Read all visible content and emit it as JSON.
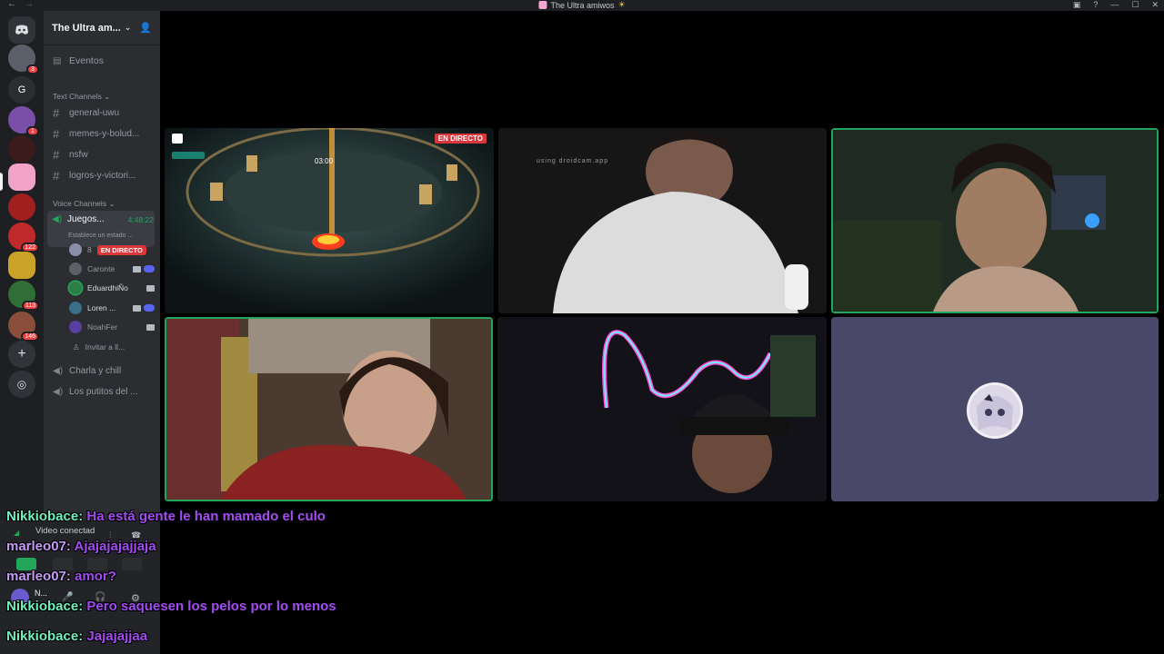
{
  "window": {
    "title": "The Ultra amiwos",
    "title_emoji": "☀"
  },
  "server": {
    "name": "The Ultra am...",
    "rail_badges": [
      "3",
      "1",
      "122",
      "113",
      "146"
    ],
    "rail_letter": "G"
  },
  "sidebar": {
    "events_label": "Eventos",
    "text_category": "Text Channels",
    "text_channels": [
      "general-uwu",
      "memes-y-bolud...",
      "nsfw",
      "logros-y-victori..."
    ],
    "voice_category": "Voice Channels",
    "active_voice": {
      "name": "Juegos...",
      "timer": "4:48:22",
      "status": "Establece un estado ...",
      "users": [
        {
          "name": "8",
          "live": "EN DIRECTO",
          "color": "#8a8ea8"
        },
        {
          "name": "Caronte",
          "color": "#5c5f66"
        },
        {
          "name": "EduardhiÑo",
          "color": "#2d7d46"
        },
        {
          "name": "Loren ...",
          "color": "#3a6f8a"
        },
        {
          "name": "NoahFer",
          "color": "#5b3fa0"
        }
      ],
      "invite": "Invitar a ll..."
    },
    "other_voice": [
      "Charla y chill",
      "Los putitos del ..."
    ]
  },
  "voice_panel": {
    "status": "Video conectad",
    "user_short": "N..."
  },
  "stage": {
    "stream_live_label": "EN DIRECTO",
    "stream_timer": "03:00",
    "droidcam_text": "using droidcam.app"
  },
  "chat": [
    {
      "user": "Nikkiobace",
      "msg": "Ha está gente le han mamado el culo"
    },
    {
      "user": "marleo07",
      "msg": "Ajajajajajjaja"
    },
    {
      "user": "marleo07",
      "msg": "amor?"
    },
    {
      "user": "Nikkiobace",
      "msg": "Pero saquesen los pelos por lo menos"
    },
    {
      "user": "Nikkiobace",
      "msg": "Jajajajjaa"
    }
  ],
  "colors": {
    "chat_user": "#6ff0c0",
    "chat_msg": "#a24cf2",
    "speaking": "#23a55a",
    "live": "#da373c"
  }
}
